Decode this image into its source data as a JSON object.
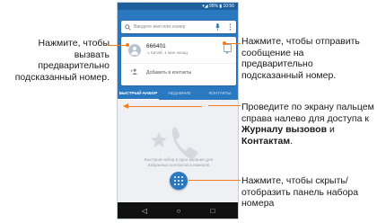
{
  "phone": {
    "status_text": "▾◢ 95% ▮ 10:56",
    "search": {
      "search_icon": "search-icon",
      "placeholder": "Введите имя или номер",
      "mic_icon": "mic-icon",
      "menu_icon": "more-vert-icon"
    },
    "suggested": {
      "number": "666401",
      "subtitle": "↘ Китай, 1 мин назад",
      "message_icon": "message-icon"
    },
    "add_contact": {
      "icon": "person-add-icon",
      "label": "Добавить в контакты"
    },
    "tabs": [
      {
        "label": "БЫСТРЫЙ НАБОР",
        "active": true
      },
      {
        "label": "НЕДАВНИЕ",
        "active": false
      },
      {
        "label": "КОНТАКТЫ",
        "active": false
      }
    ],
    "empty_hint": "Быстрый набор в одно касание для избранных контактов и номеров",
    "fab_icon": "dialpad-icon",
    "nav": {
      "back": "◁",
      "home": "○",
      "recents": "□"
    }
  },
  "callouts": {
    "left": "Нажмите, чтобы вызвать предварительно подсказанный номер.",
    "right_top": "Нажмите, чтобы отправить сообщение на предварительно подсказанный номер.",
    "right_mid": {
      "text_before": "Проведите по экрану пальцем справа налево для доступа к ",
      "strong_1": "Журналу вызовов",
      "conj": " и ",
      "strong_2": "Контактам",
      "end": "."
    },
    "right_bottom": "Нажмите, чтобы скрыть/отобразить панель набора номера"
  },
  "colors": {
    "accent": "#f47c20",
    "app_blue": "#2a78c0",
    "status_blue": "#1e5f9e"
  }
}
